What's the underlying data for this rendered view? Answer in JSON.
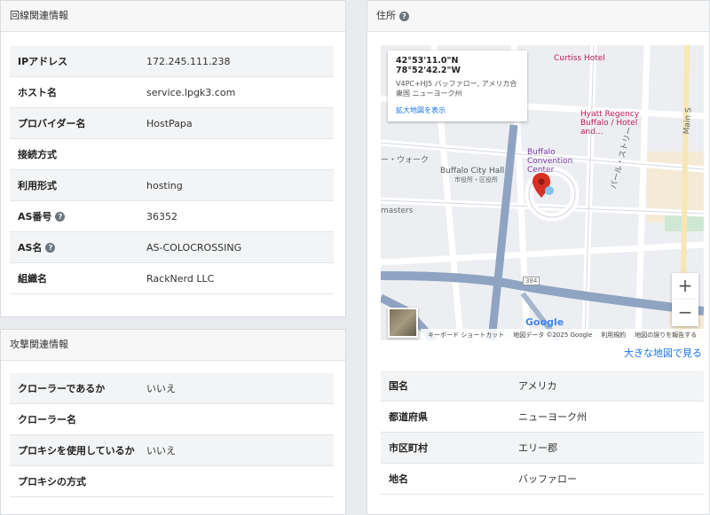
{
  "line_info": {
    "title": "回線関連情報",
    "rows": [
      {
        "key": "IPアドレス",
        "value": "172.245.111.238"
      },
      {
        "key": "ホスト名",
        "value": "service.lpgk3.com"
      },
      {
        "key": "プロバイダー名",
        "value": "HostPapa"
      },
      {
        "key": "接続方式",
        "value": ""
      },
      {
        "key": "利用形式",
        "value": "hosting"
      },
      {
        "key": "AS番号",
        "value": "36352"
      },
      {
        "key": "AS名",
        "value": "AS-COLOCROSSING"
      },
      {
        "key": "組織名",
        "value": "RackNerd LLC"
      }
    ]
  },
  "attack_info": {
    "title": "攻撃関連情報",
    "rows": [
      {
        "key": "クローラーであるか",
        "value": "いいえ"
      },
      {
        "key": "クローラー名",
        "value": ""
      },
      {
        "key": "プロキシを使用しているか",
        "value": "いいえ"
      },
      {
        "key": "プロキシの方式",
        "value": ""
      }
    ]
  },
  "address": {
    "title": "住所",
    "map": {
      "coordinates": "42°53'11.0\"N 78°52'42.2\"W",
      "address_line": "V4PC+HJ5 バッファロー, アメリカ合衆国 ニューヨーク州",
      "enlarge_link": "拡大地図を表示",
      "labels": {
        "curtiss": "Curtiss Hotel",
        "hyatt": "Hyatt Regency Buffalo / Hotel and...",
        "convention": "Buffalo Convention Center",
        "cityhall": "Buffalo City Hall",
        "cityhall_sub": "市役所・区役所",
        "walk": "ー・ウォーク",
        "masters": "masters",
        "pearl": "パール・ストリー",
        "main": "Main S",
        "route": "384",
        "google": "Google"
      },
      "zoom_in": "+",
      "zoom_out": "−",
      "footer": [
        "キーボード ショートカット",
        "地図データ ©2025 Google",
        "利用規約",
        "地図の誤りを報告する"
      ]
    },
    "bigger_map_link": "大きな地図で見る",
    "rows": [
      {
        "key": "国名",
        "value": "アメリカ"
      },
      {
        "key": "都道府県",
        "value": "ニューヨーク州"
      },
      {
        "key": "市区町村",
        "value": "エリー郡"
      },
      {
        "key": "地名",
        "value": "バッファロー"
      }
    ]
  },
  "colors": {
    "link": "#1a73e8",
    "marker": "#d93025",
    "water": "#8fa3c2"
  }
}
